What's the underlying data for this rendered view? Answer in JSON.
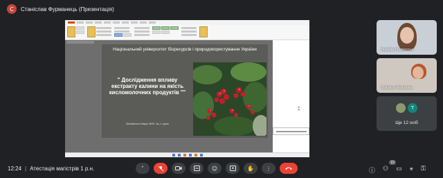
{
  "presenter": {
    "avatar_letter": "С",
    "label": "Станіслав Фурманець (Презентація)"
  },
  "slide": {
    "university": "Національний університет біоресурсів і природокористування України",
    "title": "\" Дослідження впливу екстракту калини на якість кисломолочних продуктів \"\"",
    "author": "Михайленко Марія, ВНП, 1м, 1 група"
  },
  "participants": [
    {
      "name": "Nataliia Nesterova"
    },
    {
      "name": "Svitlana Prylutska"
    }
  ],
  "others": {
    "avatar_letter": "T",
    "label": "Ще 12 осіб"
  },
  "meeting": {
    "time": "12:24",
    "separator": "|",
    "title": "Атестація магістрів 1 р.н."
  },
  "controls": {
    "icons": [
      "chevron-up-icon",
      "mic-off-icon",
      "camera-icon",
      "captions-icon",
      "emoji-icon",
      "present-icon",
      "raise-hand-icon",
      "more-icon",
      "end-call-icon"
    ],
    "end_color": "#ea4335",
    "muted_color": "#ea4335"
  },
  "participant_count": "15"
}
